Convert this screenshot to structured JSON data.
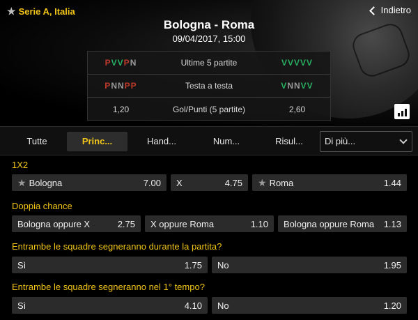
{
  "header": {
    "league": "Serie A, Italia",
    "back_label": "Indietro",
    "match_title": "Bologna - Roma",
    "match_date": "09/04/2017, 15:00"
  },
  "stats": [
    {
      "label": "Ultime 5 partite",
      "home": [
        "P",
        "V",
        "V",
        "P",
        "N"
      ],
      "away": [
        "V",
        "V",
        "V",
        "V",
        "V"
      ]
    },
    {
      "label": "Testa a testa",
      "home": [
        "P",
        "N",
        "N",
        "P",
        "P"
      ],
      "away": [
        "V",
        "N",
        "N",
        "V",
        "V"
      ]
    },
    {
      "label": "Gol/Punti (5 partite)",
      "home_value": "1,20",
      "away_value": "2,60"
    }
  ],
  "colors": {
    "accent": "#f0c419",
    "loss": "#c0392b",
    "win": "#27ae60",
    "draw": "#9a9a9a"
  },
  "tabs": [
    "Tutte",
    "Princ...",
    "Hand...",
    "Num...",
    "Risul..."
  ],
  "tabs_active": "Princ...",
  "more_dropdown": "Di più...",
  "markets": {
    "m1x2": {
      "title": "1X2",
      "odds": [
        {
          "label": "Bologna",
          "value": "7.00",
          "starred": true
        },
        {
          "label": "X",
          "value": "4.75",
          "starred": false
        },
        {
          "label": "Roma",
          "value": "1.44",
          "starred": true
        }
      ]
    },
    "doppia": {
      "title": "Doppia chance",
      "odds": [
        {
          "label": "Bologna oppure X",
          "value": "2.75"
        },
        {
          "label": "X oppure Roma",
          "value": "1.10"
        },
        {
          "label": "Bologna oppure Roma",
          "value": "1.13"
        }
      ]
    },
    "btts": {
      "title": "Entrambe le squadre segneranno durante la partita?",
      "odds": [
        {
          "label": "Sì",
          "value": "1.75"
        },
        {
          "label": "No",
          "value": "1.95"
        }
      ]
    },
    "btts_first": {
      "title": "Entrambe le squadre segneranno nel 1° tempo?",
      "odds": [
        {
          "label": "Sì",
          "value": "4.10"
        },
        {
          "label": "No",
          "value": "1.20"
        }
      ]
    }
  }
}
